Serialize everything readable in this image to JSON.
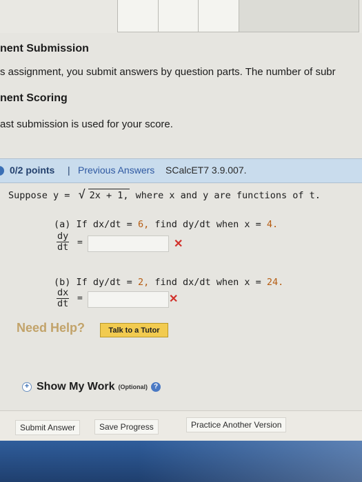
{
  "intro": {
    "heading1": "nent Submission",
    "text1": "s assignment, you submit answers by question parts. The number of subr",
    "heading2": "nent Scoring",
    "text2": "ast submission is used for your score."
  },
  "question": {
    "points": "0/2 points",
    "separator": "|",
    "previous_answers": "Previous Answers",
    "code": "SCalcET7 3.9.007.",
    "suppose": "Suppose",
    "y_eq": "y =",
    "radicand": "2x + 1,",
    "where_text": "where x and y are functions of t.",
    "part_a": {
      "label": "(a) If dx/dt =",
      "value": "6,",
      "find": "find dy/dt when x =",
      "x_value": "4.",
      "frac_top": "dy",
      "frac_bottom": "dt",
      "equals": "=",
      "answer": "",
      "mark": "✕"
    },
    "part_b": {
      "label": "(b) If dy/dt =",
      "value": "2,",
      "find": "find dx/dt when x =",
      "x_value": "24.",
      "frac_top": "dx",
      "frac_bottom": "dt",
      "equals": "=",
      "answer": "",
      "mark": "✕"
    }
  },
  "help": {
    "need_help": "Need Help?",
    "talk_to_tutor": "Talk to a Tutor"
  },
  "show_work": {
    "plus_icon": "+",
    "label": "Show My Work",
    "optional": "(Optional)",
    "help_icon": "?"
  },
  "footer": {
    "submit": "Submit Answer",
    "save": "Save Progress",
    "practice": "Practice Another Version"
  },
  "colors": {
    "header_bg": "#c9dced",
    "wrong": "#d1302a",
    "number_highlight": "#b65d13",
    "tutor_button": "#f2cb50"
  }
}
